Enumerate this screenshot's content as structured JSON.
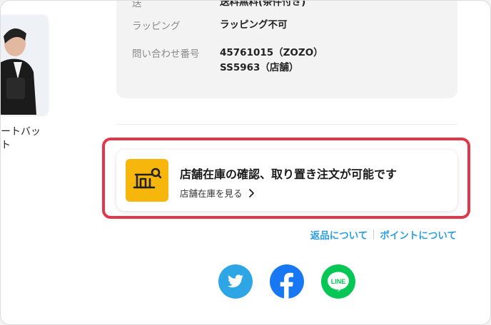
{
  "product": {
    "name": "ートバッ\nト"
  },
  "info": {
    "cut_row": {
      "label": "送",
      "value": "送料無料(条件付き)"
    },
    "wrapping": {
      "label": "ラッピング",
      "value": "ラッピング不可"
    },
    "inquiry": {
      "label": "問い合わせ番号",
      "value_line1": "45761015（ZOZO）",
      "value_line2": "SS5963（店舗）"
    }
  },
  "store_card": {
    "title": "店舗在庫の確認、取り置き注文が可能です",
    "link": "店舗在庫を見る",
    "icon": "store-search-icon",
    "accent": "#f6b60c",
    "highlight_color": "#e0374a"
  },
  "links": {
    "returns": "返品について",
    "points": "ポイントについて",
    "color": "#2d9ee0"
  },
  "social": {
    "twitter": {
      "icon": "twitter-icon",
      "color": "#2ea6e6"
    },
    "facebook": {
      "icon": "facebook-icon",
      "color": "#1877f2"
    },
    "line": {
      "icon": "line-icon",
      "label": "LINE",
      "color": "#06c655"
    }
  }
}
